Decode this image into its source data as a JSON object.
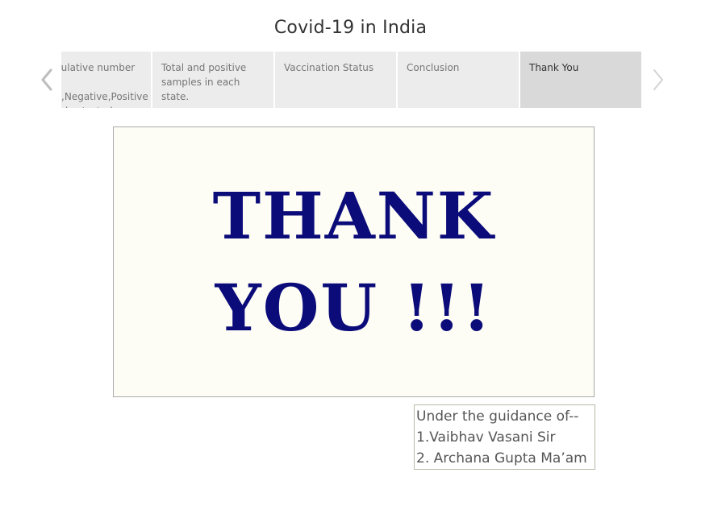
{
  "story": {
    "title": "Covid-19 in India"
  },
  "navigation": {
    "prev_icon": "chevron-left-icon",
    "next_icon": "chevron-right-icon",
    "arrow_color": "#bdbdbd"
  },
  "tabs": [
    {
      "label": "Cumulative number of Total,Negative,Positive samples tested .",
      "active": false
    },
    {
      "label": "Total and positive samples in each state.",
      "active": false
    },
    {
      "label": "Vaccination Status",
      "active": false
    },
    {
      "label": "Conclusion",
      "active": false
    },
    {
      "label": "Thank You",
      "active": true
    }
  ],
  "thank_you": {
    "line1": "THANK",
    "line2": "YOU !!!",
    "text_color": "#0b0b7a",
    "background_color": "#fdfdf5"
  },
  "guidance": {
    "line1": "Under the guidance of--",
    "line2": "1.Vaibhav Vasani Sir",
    "line3": "2. Archana Gupta Ma’am"
  }
}
